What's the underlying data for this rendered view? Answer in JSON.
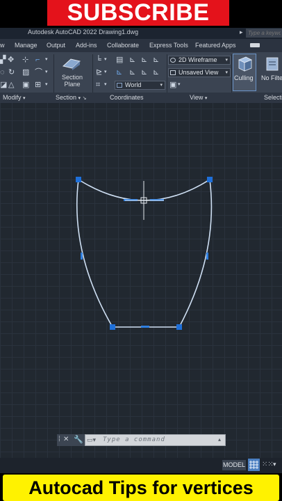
{
  "banner": {
    "subscribe": "SUBSCRIBE"
  },
  "window": {
    "title": "Autodesk AutoCAD 2022    Drawing1.dwg",
    "search_placeholder": "Type a keyword"
  },
  "menu_tabs": [
    "w",
    "Manage",
    "Output",
    "Add-ins",
    "Collaborate",
    "Express Tools",
    "Featured Apps"
  ],
  "ribbon": {
    "panels": {
      "modify": "Modify",
      "section": "Section",
      "coordinates": "Coordinates",
      "view": "View",
      "select": "Selecti"
    },
    "section_plane": "Section\nPlane",
    "ucs_world": "World",
    "visual_style": "2D Wireframe",
    "named_view": "Unsaved View",
    "culling": "Culling",
    "no_filter": "No Filte"
  },
  "command_line": {
    "placeholder": "Type a command"
  },
  "status_bar": {
    "model": "MODEL"
  },
  "caption": {
    "text": "Autocad Tips for vertices"
  },
  "colors": {
    "accent": "#4b7fc1",
    "subscribe_red": "#e4121b",
    "caption_yellow": "#fff200",
    "curve": "#cfe0f4",
    "grip": "#1e6fd9"
  }
}
